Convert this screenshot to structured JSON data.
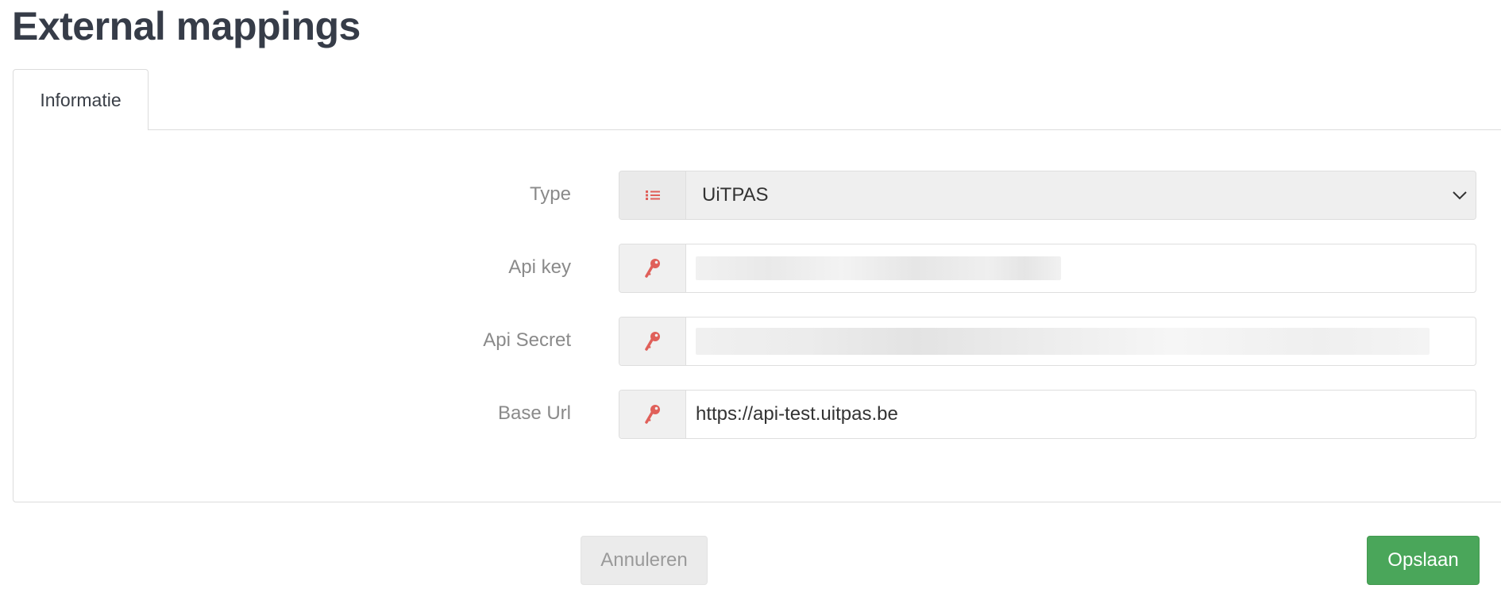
{
  "page": {
    "title": "External mappings"
  },
  "tabs": [
    {
      "label": "Informatie",
      "active": true
    }
  ],
  "form": {
    "type": {
      "label": "Type",
      "icon": "list-icon",
      "value": "UiTPAS"
    },
    "api_key": {
      "label": "Api key",
      "icon": "key-icon",
      "value": ""
    },
    "api_secret": {
      "label": "Api Secret",
      "icon": "key-icon",
      "value": ""
    },
    "base_url": {
      "label": "Base Url",
      "icon": "key-icon",
      "value": "https://api-test.uitpas.be"
    }
  },
  "actions": {
    "cancel_label": "Annuleren",
    "save_label": "Opslaan"
  },
  "colors": {
    "accent_icon": "#e0605a",
    "save_button": "#4aa65a",
    "title": "#363c48"
  }
}
